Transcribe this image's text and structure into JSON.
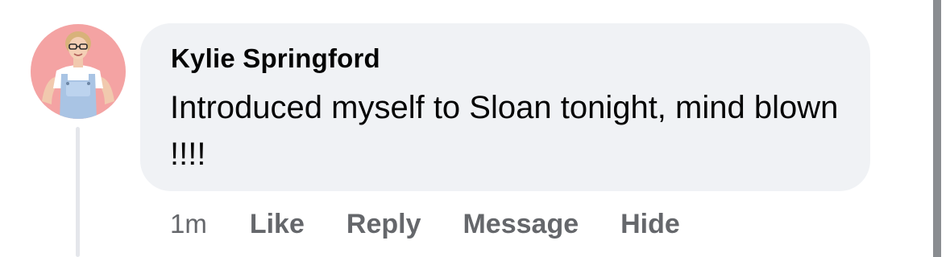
{
  "comment": {
    "author": "Kylie Springford",
    "text": "Introduced myself to Sloan tonight, mind blown !!!!",
    "timestamp": "1m",
    "avatar_icon": "profile-photo"
  },
  "actions": {
    "like": "Like",
    "reply": "Reply",
    "message": "Message",
    "hide": "Hide"
  },
  "colors": {
    "bubble_background": "#f0f2f5",
    "author_text": "#050505",
    "secondary_text": "#65676b",
    "avatar_background": "#f4a3a3"
  }
}
